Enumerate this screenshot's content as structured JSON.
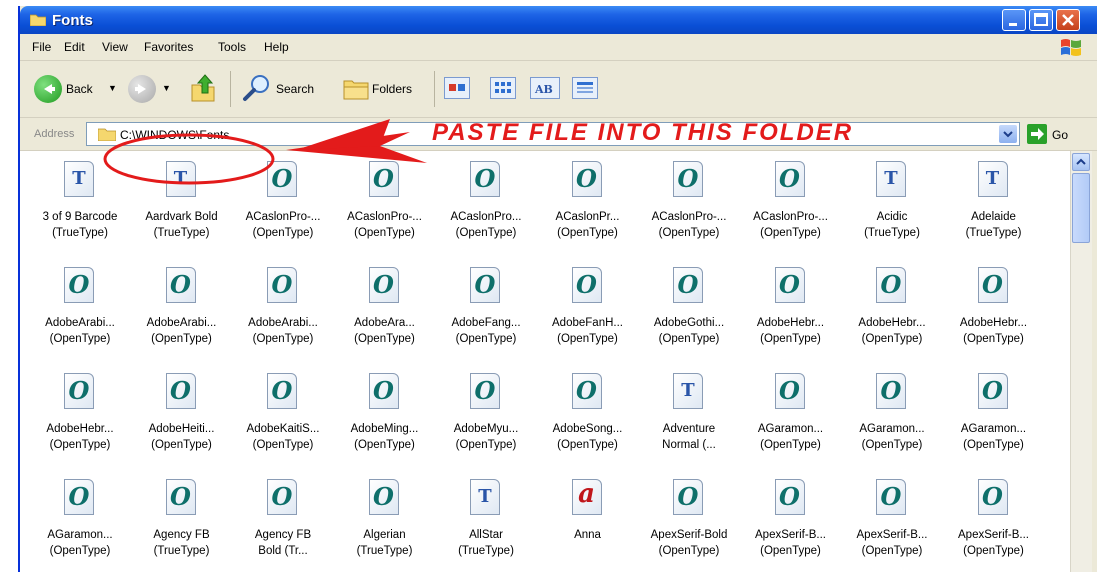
{
  "window": {
    "title": "Fonts",
    "accent_color": "#0a4fd6",
    "close_color": "#d2451b"
  },
  "menu": [
    "File",
    "Edit",
    "View",
    "Favorites",
    "Tools",
    "Help"
  ],
  "toolbar": {
    "back_label": "Back",
    "search_label": "Search",
    "folders_label": "Folders"
  },
  "address": {
    "label": "Address",
    "path": "C:\\WINDOWS\\Fonts",
    "go_label": "Go"
  },
  "annotation": {
    "text": "PASTE FILE INTO THIS FOLDER",
    "color": "#e31b1b"
  },
  "icon_types": {
    "ot": "opentype-font-icon",
    "tt": "truetype-font-icon",
    "a": "font-file-icon"
  },
  "files": [
    {
      "name": "3 of 9 Barcode",
      "kind": "(TrueType)",
      "icon": "tt"
    },
    {
      "name": "Aardvark Bold",
      "kind": "(TrueType)",
      "icon": "tt"
    },
    {
      "name": "ACaslonPro-...",
      "kind": "(OpenType)",
      "icon": "ot"
    },
    {
      "name": "ACaslonPro-...",
      "kind": "(OpenType)",
      "icon": "ot"
    },
    {
      "name": "ACaslonPro...",
      "kind": "(OpenType)",
      "icon": "ot"
    },
    {
      "name": "ACaslonPr...",
      "kind": "(OpenType)",
      "icon": "ot"
    },
    {
      "name": "ACaslonPro-...",
      "kind": "(OpenType)",
      "icon": "ot"
    },
    {
      "name": "ACaslonPro-...",
      "kind": "(OpenType)",
      "icon": "ot"
    },
    {
      "name": "Acidic",
      "kind": "(TrueType)",
      "icon": "tt"
    },
    {
      "name": "Adelaide",
      "kind": "(TrueType)",
      "icon": "tt"
    },
    {
      "name": "AdobeArabi...",
      "kind": "(OpenType)",
      "icon": "ot"
    },
    {
      "name": "AdobeArabi...",
      "kind": "(OpenType)",
      "icon": "ot"
    },
    {
      "name": "AdobeArabi...",
      "kind": "(OpenType)",
      "icon": "ot"
    },
    {
      "name": "AdobeAra...",
      "kind": "(OpenType)",
      "icon": "ot"
    },
    {
      "name": "AdobeFang...",
      "kind": "(OpenType)",
      "icon": "ot"
    },
    {
      "name": "AdobeFanH...",
      "kind": "(OpenType)",
      "icon": "ot"
    },
    {
      "name": "AdobeGothi...",
      "kind": "(OpenType)",
      "icon": "ot"
    },
    {
      "name": "AdobeHebr...",
      "kind": "(OpenType)",
      "icon": "ot"
    },
    {
      "name": "AdobeHebr...",
      "kind": "(OpenType)",
      "icon": "ot"
    },
    {
      "name": "AdobeHebr...",
      "kind": "(OpenType)",
      "icon": "ot"
    },
    {
      "name": "AdobeHebr...",
      "kind": "(OpenType)",
      "icon": "ot"
    },
    {
      "name": "AdobeHeiti...",
      "kind": "(OpenType)",
      "icon": "ot"
    },
    {
      "name": "AdobeKaitiS...",
      "kind": "(OpenType)",
      "icon": "ot"
    },
    {
      "name": "AdobeMing...",
      "kind": "(OpenType)",
      "icon": "ot"
    },
    {
      "name": "AdobeMyu...",
      "kind": "(OpenType)",
      "icon": "ot"
    },
    {
      "name": "AdobeSong...",
      "kind": "(OpenType)",
      "icon": "ot"
    },
    {
      "name": "Adventure",
      "kind": "Normal (...",
      "icon": "tt"
    },
    {
      "name": "AGaramon...",
      "kind": "(OpenType)",
      "icon": "ot"
    },
    {
      "name": "AGaramon...",
      "kind": "(OpenType)",
      "icon": "ot"
    },
    {
      "name": "AGaramon...",
      "kind": "(OpenType)",
      "icon": "ot"
    },
    {
      "name": "AGaramon...",
      "kind": "(OpenType)",
      "icon": "ot"
    },
    {
      "name": "Agency FB",
      "kind": "(TrueType)",
      "icon": "ot"
    },
    {
      "name": "Agency FB",
      "kind": "Bold (Tr...",
      "icon": "ot"
    },
    {
      "name": "Algerian",
      "kind": "(TrueType)",
      "icon": "ot"
    },
    {
      "name": "AllStar",
      "kind": "(TrueType)",
      "icon": "tt"
    },
    {
      "name": "Anna",
      "kind": "",
      "icon": "a"
    },
    {
      "name": "ApexSerif-Bold",
      "kind": "(OpenType)",
      "icon": "ot"
    },
    {
      "name": "ApexSerif-B...",
      "kind": "(OpenType)",
      "icon": "ot"
    },
    {
      "name": "ApexSerif-B...",
      "kind": "(OpenType)",
      "icon": "ot"
    },
    {
      "name": "ApexSerif-B...",
      "kind": "(OpenType)",
      "icon": "ot"
    }
  ]
}
